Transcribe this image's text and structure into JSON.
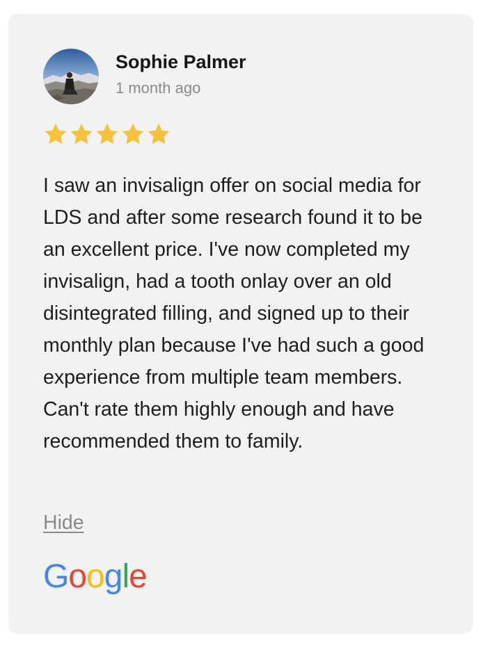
{
  "review": {
    "author_name": "Sophie Palmer",
    "date": "1 month ago",
    "rating": 5,
    "star_color": "#F6C23A",
    "text": "I saw an invisalign offer on social media for LDS and after some research found it to be an excellent price. I've now completed my invisalign, had a tooth onlay over an old disintegrated filling, and signed up to their monthly plan because I've had such a good experience from multiple team members. Can't rate them highly enough and have recommended them to family.",
    "hide_label": "Hide"
  },
  "source": {
    "logo_letters": [
      "G",
      "o",
      "o",
      "g",
      "l",
      "e"
    ],
    "logo_colors": [
      "#4285F4",
      "#EA4335",
      "#FBBC05",
      "#4285F4",
      "#34A853",
      "#EA4335"
    ]
  }
}
